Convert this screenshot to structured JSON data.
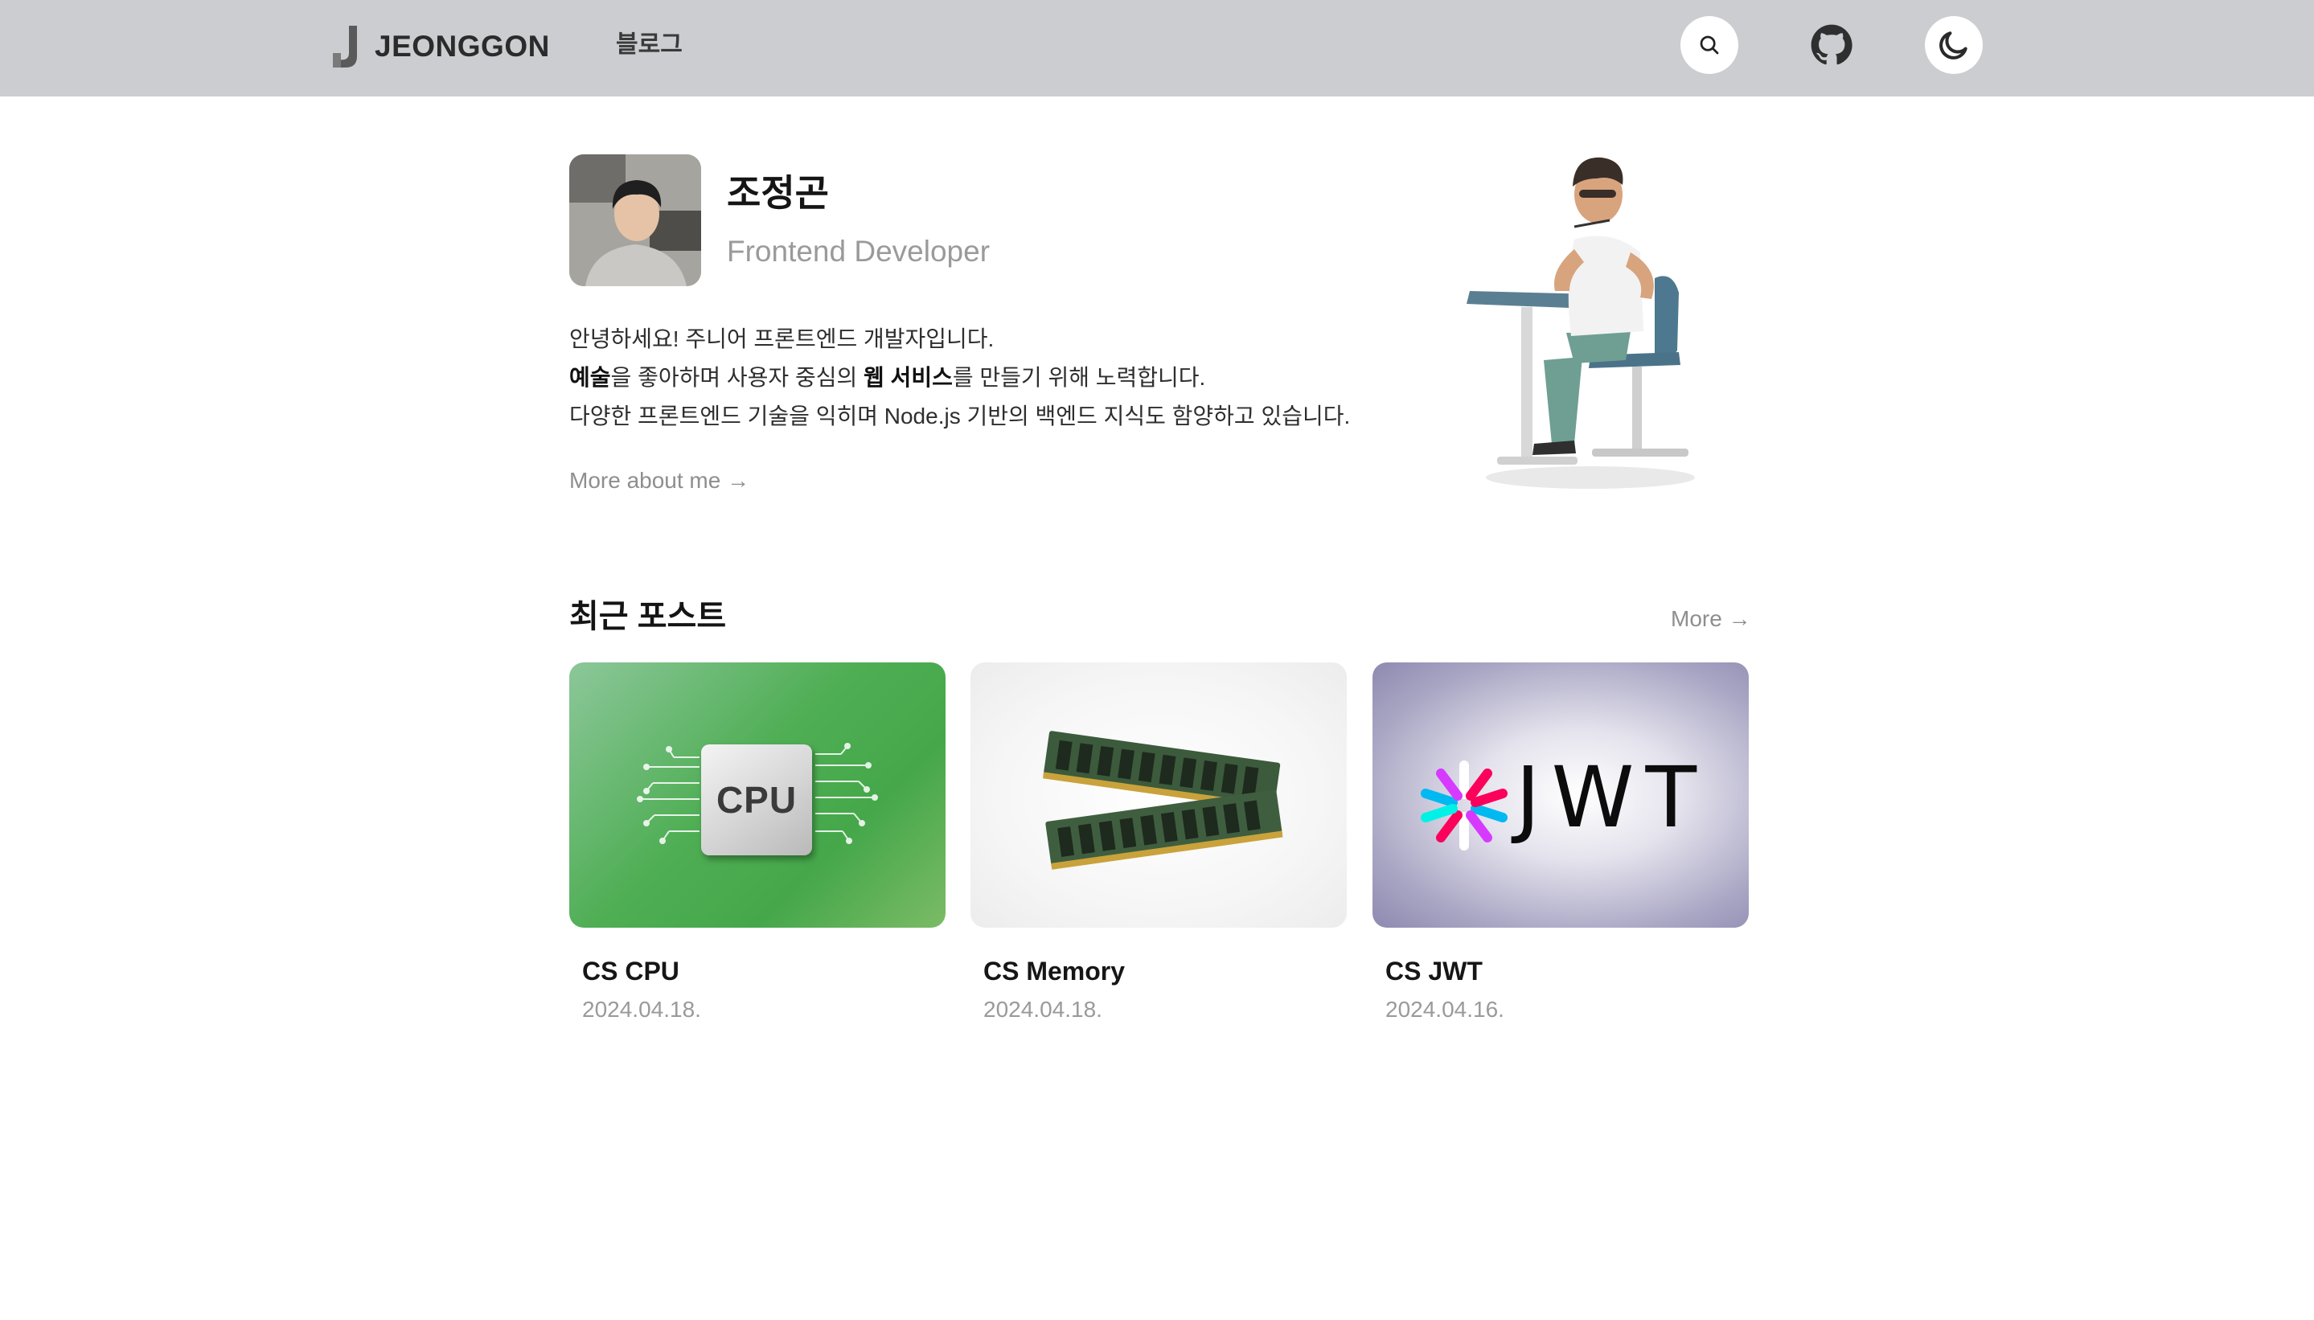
{
  "header": {
    "logo_text": "JEONGGON",
    "nav_blog": "블로그"
  },
  "profile": {
    "name": "조정곤",
    "role": "Frontend Developer",
    "intro_line1": "안녕하세요! 주니어 프론트엔드 개발자입니다.",
    "intro_line2_bold1": "예술",
    "intro_line2_part1": "을 좋아하며 사용자 중심의 ",
    "intro_line2_bold2": "웹 서비스",
    "intro_line2_part2": "를 만들기 위해 노력합니다.",
    "intro_line3": "다양한 프론트엔드 기술을 익히며 Node.js 기반의 백엔드 지식도 함양하고 있습니다.",
    "more_about": "More about me →"
  },
  "recent": {
    "title": "최근 포스트",
    "more": "More →",
    "posts": [
      {
        "title": "CS CPU",
        "date": "2024.04.18.",
        "thumb_text": "CPU"
      },
      {
        "title": "CS Memory",
        "date": "2024.04.18."
      },
      {
        "title": "CS JWT",
        "date": "2024.04.16.",
        "thumb_text": "JWT"
      }
    ]
  },
  "colors": {
    "header_bg": "#cccdd1",
    "muted_text": "#9a9a9a",
    "cpu_green": "#4fae54",
    "jwt_purple": "#8e89b0"
  },
  "icons": [
    "logo-j-icon",
    "search-icon",
    "github-icon",
    "moon-icon",
    "arrow-right-icon"
  ]
}
